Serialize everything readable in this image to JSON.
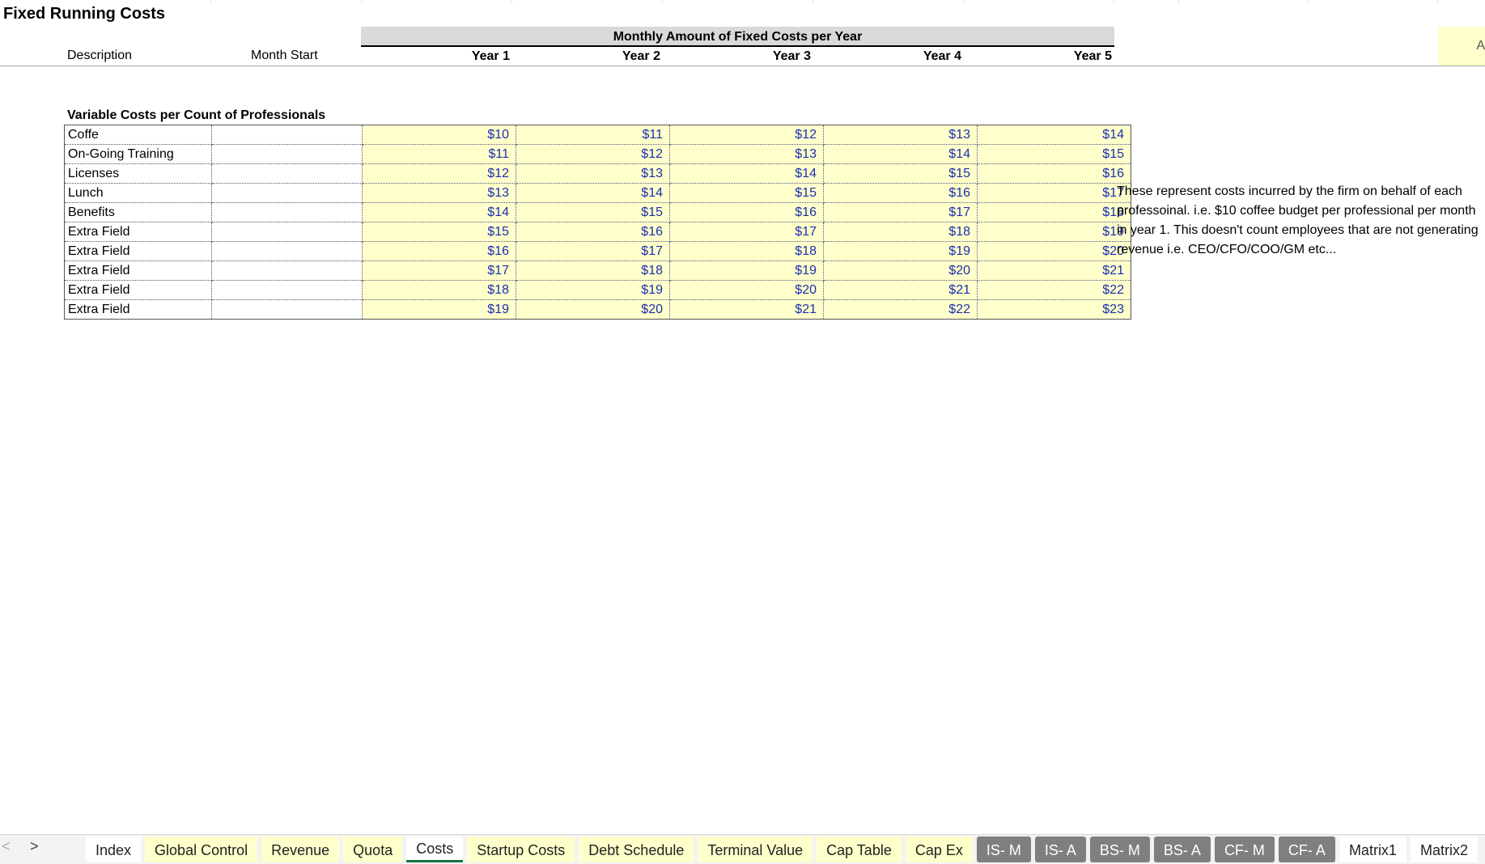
{
  "sheet": {
    "title": "Fixed Running Costs",
    "header_band": "Monthly Amount of Fixed Costs per Year",
    "col_description": "Description",
    "col_month_start": "Month Start",
    "years": [
      "Year 1",
      "Year 2",
      "Year 3",
      "Year 4",
      "Year 5"
    ],
    "corner_char": "A"
  },
  "section": {
    "title": "Variable Costs per Count of Professionals",
    "rows": [
      {
        "label": "Coffe",
        "month_start": "",
        "values": [
          "$10",
          "$11",
          "$12",
          "$13",
          "$14"
        ]
      },
      {
        "label": "On-Going Training",
        "month_start": "",
        "values": [
          "$11",
          "$12",
          "$13",
          "$14",
          "$15"
        ]
      },
      {
        "label": "Licenses",
        "month_start": "",
        "values": [
          "$12",
          "$13",
          "$14",
          "$15",
          "$16"
        ]
      },
      {
        "label": "Lunch",
        "month_start": "",
        "values": [
          "$13",
          "$14",
          "$15",
          "$16",
          "$17"
        ]
      },
      {
        "label": "Benefits",
        "month_start": "",
        "values": [
          "$14",
          "$15",
          "$16",
          "$17",
          "$18"
        ]
      },
      {
        "label": "Extra Field",
        "month_start": "",
        "values": [
          "$15",
          "$16",
          "$17",
          "$18",
          "$19"
        ]
      },
      {
        "label": "Extra Field",
        "month_start": "",
        "values": [
          "$16",
          "$17",
          "$18",
          "$19",
          "$20"
        ]
      },
      {
        "label": "Extra Field",
        "month_start": "",
        "values": [
          "$17",
          "$18",
          "$19",
          "$20",
          "$21"
        ]
      },
      {
        "label": "Extra Field",
        "month_start": "",
        "values": [
          "$18",
          "$19",
          "$20",
          "$21",
          "$22"
        ]
      },
      {
        "label": "Extra Field",
        "month_start": "",
        "values": [
          "$19",
          "$20",
          "$21",
          "$22",
          "$23"
        ]
      }
    ],
    "note_lines": [
      "These represent costs incurred by the firm on behalf of each",
      "professoinal. i.e. $10 coffee budget per professional per month",
      "in year 1. This doesn't count employees that are not generating",
      "revenue i.e. CEO/CFO/COO/GM etc..."
    ]
  },
  "tabbar": {
    "prev_icon": "chevron-left-icon",
    "next_icon": "chevron-right-icon",
    "prev_glyph": "<",
    "next_glyph": ">",
    "tabs": [
      {
        "label": "Index",
        "style": "white"
      },
      {
        "label": "Global Control",
        "style": "yellow"
      },
      {
        "label": "Revenue",
        "style": "yellow"
      },
      {
        "label": "Quota",
        "style": "yellow"
      },
      {
        "label": "Costs",
        "style": "active"
      },
      {
        "label": "Startup Costs",
        "style": "yellow"
      },
      {
        "label": "Debt Schedule",
        "style": "yellow"
      },
      {
        "label": "Terminal Value",
        "style": "yellow"
      },
      {
        "label": "Cap Table",
        "style": "yellow"
      },
      {
        "label": "Cap Ex",
        "style": "yellow"
      },
      {
        "label": "IS- M",
        "style": "dark"
      },
      {
        "label": "IS- A",
        "style": "dark"
      },
      {
        "label": "BS- M",
        "style": "dark"
      },
      {
        "label": "BS- A",
        "style": "dark"
      },
      {
        "label": "CF- M",
        "style": "dark"
      },
      {
        "label": "CF- A",
        "style": "dark"
      },
      {
        "label": "Matrix1",
        "style": "white"
      },
      {
        "label": "Matrix2",
        "style": "white"
      }
    ]
  },
  "colors": {
    "input_fill": "#ffffcc",
    "input_text": "#1a2fb0",
    "header_band": "#d9d9d9",
    "dark_tab": "#7f7f7f",
    "active_tab_underline": "#1e7145"
  }
}
